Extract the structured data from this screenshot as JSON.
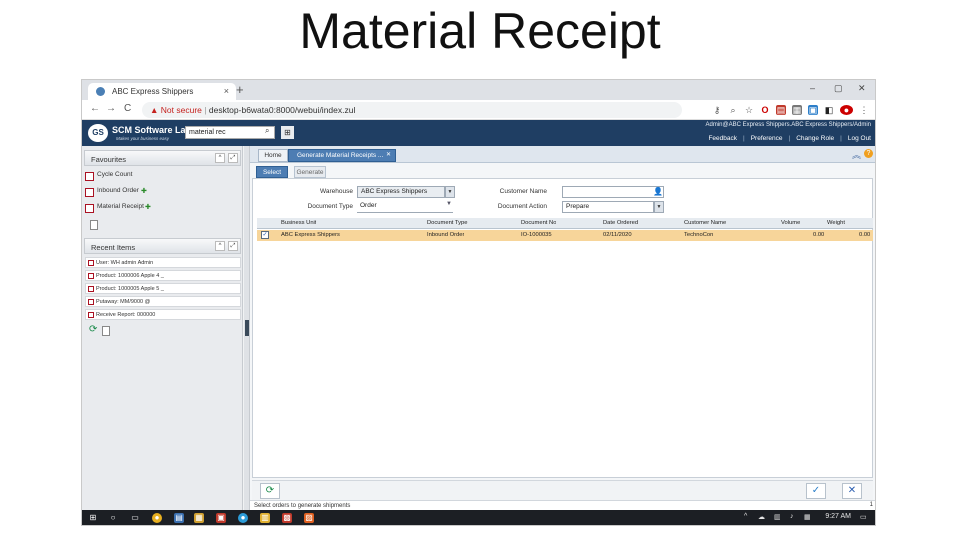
{
  "slide": {
    "title": "Material Receipt"
  },
  "browser": {
    "tab_title": "ABC Express Shippers",
    "tab_close": "×",
    "new_tab": "+",
    "window_min": "–",
    "window_max": "▢",
    "window_close": "✕",
    "back": "←",
    "forward": "→",
    "reload": "C",
    "url_warning": "▲ Not secure",
    "url_sep": "|",
    "url": "desktop-b6wata0:8000/webui/index.zul",
    "icons": [
      "key-icon",
      "zoom-icon",
      "star-icon",
      "opera-icon",
      "pdf-icon",
      "extension-icon",
      "vpn-icon",
      "cube-icon",
      "stop-icon",
      "menu-icon"
    ]
  },
  "app": {
    "logo_initials": "GS",
    "logo_title": "SCM Software Lab",
    "logo_tagline": "Makes your business easy",
    "search_value": "material rec",
    "user_line": "Admin@ABC Express Shippers.ABC Express Shippers/Admin",
    "links": [
      "Feedback",
      "Preference",
      "Change Role",
      "Log Out"
    ]
  },
  "left_panel": {
    "favourites_header": "Favourites",
    "favourites": [
      "Cycle Count",
      "Inbound Order",
      "Material Receipt"
    ],
    "recent_header": "Recent Items",
    "recent": [
      "User: WH admin Admin",
      "Product: 1000006 Apple 4 _",
      "Product: 1000005 Apple 5 _",
      "Putaway: MM/9000 @",
      "Receive Report: 000000"
    ]
  },
  "main": {
    "home_tab": "Home",
    "active_tab": "Generate Material Receipts ...",
    "subtab_select": "Select",
    "subtab_generate": "Generate",
    "form": {
      "warehouse_label": "Warehouse",
      "warehouse_value": "ABC Express Shippers",
      "customer_label": "Customer Name",
      "customer_value": "",
      "doctype_label": "Document Type",
      "doctype_value": "Order",
      "docaction_label": "Document Action",
      "docaction_value": "Prepare"
    },
    "table": {
      "headers": [
        "Business Unit",
        "Document Type",
        "Document No",
        "Date Ordered",
        "Customer Name",
        "Volume",
        "Weight"
      ],
      "rows": [
        [
          "ABC Express Shippers",
          "Inbound Order",
          "IO-1000035",
          "02/11/2020",
          "TechnoCon",
          "0.00",
          "0.00"
        ]
      ]
    },
    "ok_icon": "✓",
    "cancel_icon": "✕",
    "status_text": "Select orders to generate shipments",
    "page_marker": "1"
  },
  "taskbar": {
    "time": "9:27 AM",
    "icons": [
      "windows-icon",
      "search-icon",
      "taskview-icon",
      "chrome-icon",
      "app1-icon",
      "app2-icon",
      "app3-icon",
      "app4-icon",
      "app5-icon",
      "app6-icon",
      "app7-icon"
    ]
  },
  "colors": {
    "header_bg": "#1f3e63",
    "tab_active": "#4d7db3",
    "selected_row": "#f7d59a",
    "taskbar": "#1c1f24"
  }
}
